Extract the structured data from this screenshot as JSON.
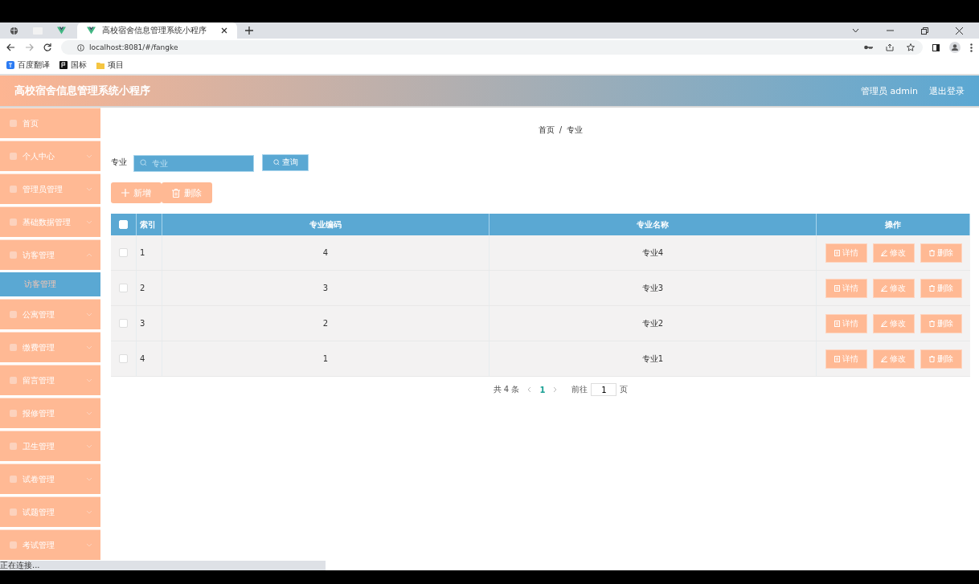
{
  "browser": {
    "tabs": [
      {
        "kind": "globe",
        "selected": false
      },
      {
        "kind": "blank",
        "selected": false
      },
      {
        "kind": "vue",
        "selected": false
      },
      {
        "kind": "vue",
        "title": "高校宿舍信息管理系统小程序",
        "selected": true
      }
    ],
    "address": "localhost:8081/#/fangke",
    "bookmarks": [
      {
        "label": "百度翻译",
        "kind": "translate"
      },
      {
        "label": "国标",
        "kind": "flag"
      },
      {
        "label": "项目",
        "kind": "folder"
      }
    ],
    "status": "正在连接..."
  },
  "header": {
    "title": "高校宿舍信息管理系统小程序",
    "user": "管理员 admin",
    "logout": "退出登录"
  },
  "sidebar": {
    "items": [
      {
        "label": "首页",
        "kind": "link"
      },
      {
        "label": "个人中心",
        "kind": "group",
        "expanded": false
      },
      {
        "label": "管理员管理",
        "kind": "group",
        "expanded": false
      },
      {
        "label": "基础数据管理",
        "kind": "group",
        "expanded": false
      },
      {
        "label": "访客管理",
        "kind": "group",
        "expanded": true,
        "children": [
          {
            "label": "访客管理",
            "selected": true
          }
        ]
      },
      {
        "label": "公寓管理",
        "kind": "group",
        "expanded": false
      },
      {
        "label": "缴费管理",
        "kind": "group",
        "expanded": false
      },
      {
        "label": "留言管理",
        "kind": "group",
        "expanded": false
      },
      {
        "label": "报修管理",
        "kind": "group",
        "expanded": false
      },
      {
        "label": "卫生管理",
        "kind": "group",
        "expanded": false
      },
      {
        "label": "试卷管理",
        "kind": "group",
        "expanded": false
      },
      {
        "label": "试题管理",
        "kind": "group",
        "expanded": false
      },
      {
        "label": "考试管理",
        "kind": "group",
        "expanded": false
      }
    ]
  },
  "breadcrumb": [
    "首页",
    "/",
    "专业"
  ],
  "search": {
    "label": "专业",
    "placeholder": "专业",
    "button": "查询"
  },
  "actions": [
    {
      "kind": "add",
      "label": "新增"
    },
    {
      "kind": "delete",
      "label": "删除"
    }
  ],
  "table": {
    "header_checked": false,
    "columns": [
      "索引",
      "专业编码",
      "专业名称",
      "操作"
    ],
    "rows": [
      {
        "checked": false,
        "index": "1",
        "code": "4",
        "name": "专业4",
        "actions": [
          {
            "kind": "detail",
            "label": "详情"
          },
          {
            "kind": "edit",
            "label": "修改"
          },
          {
            "kind": "delete",
            "label": "删除"
          }
        ]
      },
      {
        "checked": false,
        "index": "2",
        "code": "3",
        "name": "专业3",
        "actions": [
          {
            "kind": "detail",
            "label": "详情"
          },
          {
            "kind": "edit",
            "label": "修改"
          },
          {
            "kind": "delete",
            "label": "删除"
          }
        ]
      },
      {
        "checked": false,
        "index": "3",
        "code": "2",
        "name": "专业2",
        "actions": [
          {
            "kind": "detail",
            "label": "详情"
          },
          {
            "kind": "edit",
            "label": "修改"
          },
          {
            "kind": "delete",
            "label": "删除"
          }
        ]
      },
      {
        "checked": false,
        "index": "4",
        "code": "1",
        "name": "专业1",
        "actions": [
          {
            "kind": "detail",
            "label": "详情"
          },
          {
            "kind": "edit",
            "label": "修改"
          },
          {
            "kind": "delete",
            "label": "删除"
          }
        ]
      }
    ]
  },
  "pagination": {
    "total": "共 4 条",
    "pages": [
      {
        "label": "1",
        "selected": true
      }
    ],
    "goto": "前往",
    "page_value": "1",
    "page_suffix": "页"
  }
}
